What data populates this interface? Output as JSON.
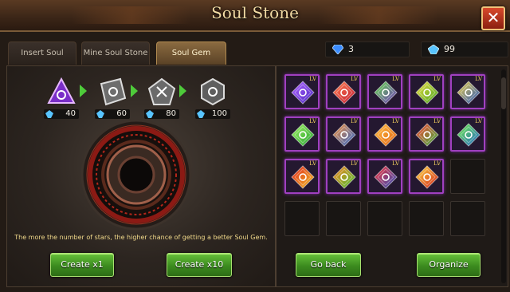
{
  "window": {
    "title": "Soul Stone"
  },
  "tabs": [
    {
      "label": "Insert Soul Stone",
      "active": false
    },
    {
      "label": "Mine Soul Stone",
      "active": false
    },
    {
      "label": "Soul Gem",
      "active": true
    }
  ],
  "resources": [
    {
      "icon": "blue-diamond-icon",
      "value": "3",
      "color": "#3b8cff"
    },
    {
      "icon": "cyan-crystal-icon",
      "value": "99",
      "color": "#58c4ff"
    }
  ],
  "recipe": [
    {
      "icon": "purple-triangle-stone-icon",
      "cost": "40"
    },
    {
      "icon": "grey-square-stone-icon",
      "cost": "60"
    },
    {
      "icon": "grey-pentagon-stone-icon",
      "cost": "80"
    },
    {
      "icon": "grey-hexagon-stone-icon",
      "cost": "100"
    }
  ],
  "hint": "The more the number of stars, the higher chance of getting a better Soul Gem.",
  "buttons": {
    "create_x1": "Create x1",
    "create_x10": "Create x10",
    "go_back": "Go back",
    "organize": "Organize"
  },
  "inventory": {
    "level_label": "LV",
    "slots": [
      {
        "gem": "blue-purple",
        "colors": [
          "#4a2ac0",
          "#b060ff"
        ]
      },
      {
        "gem": "red",
        "colors": [
          "#c01830",
          "#ff8050"
        ]
      },
      {
        "gem": "purple-green",
        "colors": [
          "#7030c0",
          "#60e040"
        ]
      },
      {
        "gem": "green-yellow",
        "colors": [
          "#40a020",
          "#f0e040"
        ]
      },
      {
        "gem": "blue-yellow",
        "colors": [
          "#2050c0",
          "#f0d040"
        ]
      },
      {
        "gem": "green",
        "colors": [
          "#20a030",
          "#a0f060"
        ]
      },
      {
        "gem": "blue-orange",
        "colors": [
          "#2060d0",
          "#ff9030"
        ]
      },
      {
        "gem": "orange",
        "colors": [
          "#e06010",
          "#ffc040"
        ]
      },
      {
        "gem": "green-red",
        "colors": [
          "#30b040",
          "#ff4030"
        ]
      },
      {
        "gem": "blue-green",
        "colors": [
          "#2060d0",
          "#70f040"
        ]
      },
      {
        "gem": "yellow-red",
        "colors": [
          "#f0c020",
          "#e02020"
        ]
      },
      {
        "gem": "green-orange",
        "colors": [
          "#40c030",
          "#ff8020"
        ]
      },
      {
        "gem": "blue-red",
        "colors": [
          "#2050c0",
          "#ff3030"
        ]
      },
      {
        "gem": "red-yellow",
        "colors": [
          "#d01818",
          "#ffe040"
        ]
      },
      null,
      null,
      null,
      null,
      null,
      null
    ]
  }
}
